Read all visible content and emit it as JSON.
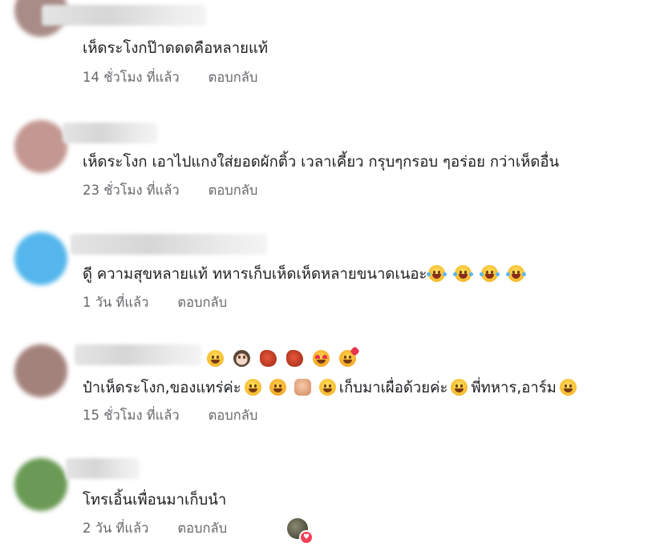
{
  "comments": [
    {
      "text": "เห็ดระโงกป๊าดดดคือหลายแท้",
      "time": "14 ชั่วโมง ที่แล้ว",
      "reply": "ตอบกลับ"
    },
    {
      "text": "เห็ดระโงก เอาไปแกงใส่ยอดผักติ้ว เวลาเคี้ยว กรุบๆกรอบ ๆอร่อย กว่าเห็ดอื่น",
      "time": "23 ชั่วโมง ที่แล้ว",
      "reply": "ตอบกลับ"
    },
    {
      "text": "ดูี ความสุขหลายแท้ ทหารเก็บเห็ดเห็ดหลายขนาดเนอะ",
      "time": "1 วัน ที่แล้ว",
      "reply": "ตอบกลับ",
      "emoji": [
        "face-tears-of-joy-icon",
        "face-tears-of-joy-icon",
        "face-tears-of-joy-icon",
        "face-tears-of-joy-icon"
      ]
    },
    {
      "name_emoji": [
        "smiling-face-icon",
        "person-icon",
        "meat-icon",
        "meat-icon",
        "heart-eyes-icon",
        "smiling-face-with-hearts-icon"
      ],
      "text_parts": [
        "ป๋าเห็ดระโงก,ของแทร่ค่ะ",
        "เก็บมาเผื่อด้วยค่ะ",
        "พี่ทหาร,อาร์ม"
      ],
      "time": "15 ชั่วโมง ที่แล้ว",
      "reply": "ตอบกลับ"
    },
    {
      "text": "โทรเอิ้นเพื่อนมาเก็บนำ",
      "time": "2 วัน ที่แล้ว",
      "reply": "ตอบกลับ",
      "reaction": "heart-reaction-icon"
    }
  ],
  "colors": {
    "text": "#1c1e21",
    "meta": "#65676b",
    "heart": "#f33e58"
  }
}
